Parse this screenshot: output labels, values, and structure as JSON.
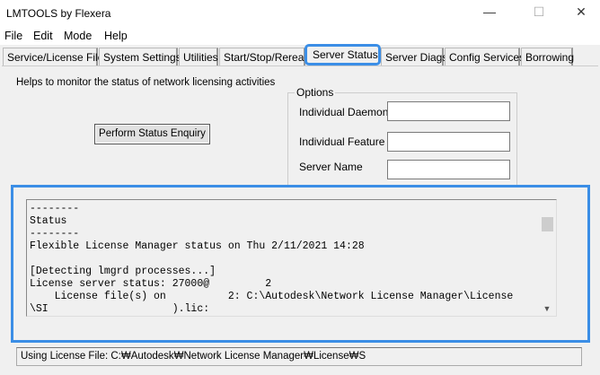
{
  "window": {
    "title": "LMTOOLS by Flexera",
    "minimize": "—",
    "maximize": "☐",
    "close": "✕"
  },
  "menu": [
    "File",
    "Edit",
    "Mode",
    "Help"
  ],
  "tabs": [
    "Service/License File",
    "System Settings",
    "Utilities",
    "Start/Stop/Reread",
    "Server Status",
    "Server Diags",
    "Config Services",
    "Borrowing"
  ],
  "active_tab": "Server Status",
  "description": "Helps to monitor the status of network licensing activities",
  "options": {
    "title": "Options",
    "individual_daemon": "Individual Daemon",
    "individual_feature": "Individual Feature",
    "server_name": "Server Name",
    "daemon_value": "",
    "feature_value": "",
    "server_value": ""
  },
  "enquiry_button": "Perform Status Enquiry",
  "output": "--------\nStatus\n--------\nFlexible License Manager status on Thu 2/11/2021 14:28\n\n[Detecting lmgrd processes...]\nLicense server status: 27000@         2\n    License file(s) on          2: C:\\Autodesk\\Network License Manager\\License\n\\SI                    ).lic:",
  "status_bar": "Using License File:  C:₩Autodesk₩Network License Manager₩License₩S"
}
